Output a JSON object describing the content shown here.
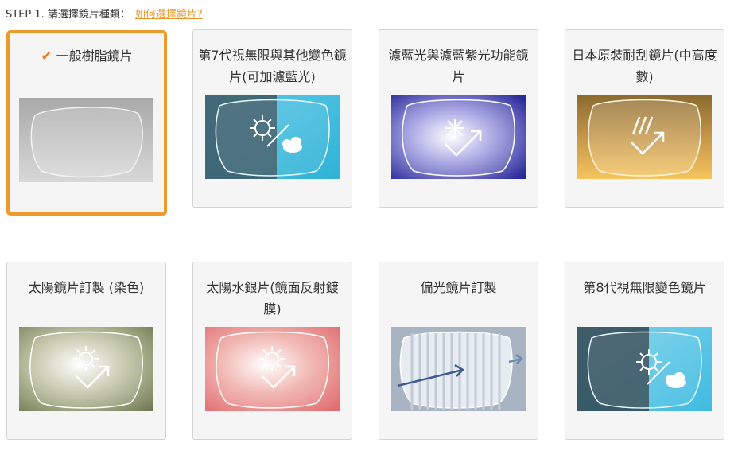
{
  "header": {
    "step_label": "STEP 1. 請選擇鏡片種類：",
    "help_link": "如何選擇鏡片?"
  },
  "accent_color": "#ed9a2b",
  "selected_index": 0,
  "lens_options": [
    {
      "title": "一般樹脂鏡片",
      "icon": "check-icon",
      "selected": true
    },
    {
      "title": "第7代視無限與其他變色鏡片(可加濾藍光)",
      "selected": false
    },
    {
      "title": "濾藍光與濾藍紫光功能鏡片",
      "selected": false
    },
    {
      "title": "日本原裝耐刮鏡片(中高度數)",
      "selected": false
    },
    {
      "title": "太陽鏡片訂製 (染色)",
      "selected": false
    },
    {
      "title": "太陽水銀片(鏡面反射鍍膜)",
      "selected": false
    },
    {
      "title": "偏光鏡片訂製",
      "selected": false
    },
    {
      "title": "第8代視無限變色鏡片",
      "selected": false
    }
  ]
}
